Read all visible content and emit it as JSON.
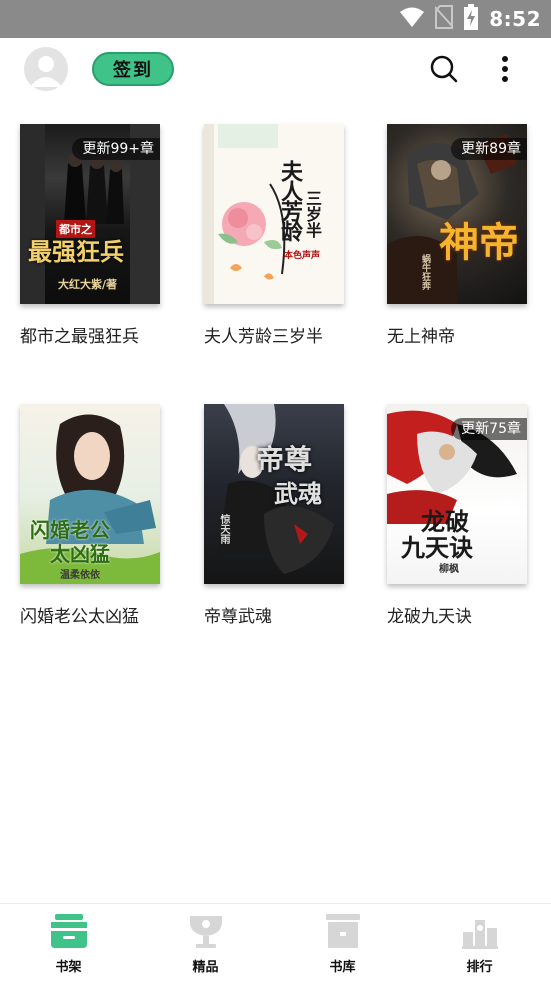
{
  "status_bar": {
    "time": "8:52",
    "icons": [
      "wifi-icon",
      "no-sim-icon",
      "battery-charging-icon"
    ]
  },
  "header": {
    "checkin_label": "签到",
    "icons": [
      "avatar-icon",
      "search-icon",
      "more-vertical-icon"
    ]
  },
  "books": [
    {
      "title": "都市之最强狂兵",
      "badge": "更新99+章",
      "cover_text": "都市之最强狂兵",
      "author": "大红大紫/著"
    },
    {
      "title": "夫人芳龄三岁半",
      "badge": "",
      "cover_text": "夫人芳龄三岁半",
      "author": "本色声声"
    },
    {
      "title": "无上神帝",
      "badge": "更新89章",
      "cover_text": "神帝",
      "author": "蜗牛狂奔"
    },
    {
      "title": "闪婚老公太凶猛",
      "badge": "",
      "cover_text": "闪婚老公太凶猛",
      "author": "温柔依依"
    },
    {
      "title": "帝尊武魂",
      "badge": "",
      "cover_text": "帝尊武魂",
      "author": "惊天雨"
    },
    {
      "title": "龙破九天诀",
      "badge": "更新75章",
      "cover_text": "龙破九天诀",
      "author": "柳枫"
    }
  ],
  "bottom_nav": [
    {
      "label": "书架",
      "icon": "bookshelf-icon",
      "active": true
    },
    {
      "label": "精品",
      "icon": "trophy-icon",
      "active": false
    },
    {
      "label": "书库",
      "icon": "library-icon",
      "active": false
    },
    {
      "label": "排行",
      "icon": "ranking-icon",
      "active": false
    }
  ],
  "colors": {
    "accent": "#3fc389",
    "status_bar": "#8a8a8a",
    "inactive_icon": "#d6d6d6"
  }
}
